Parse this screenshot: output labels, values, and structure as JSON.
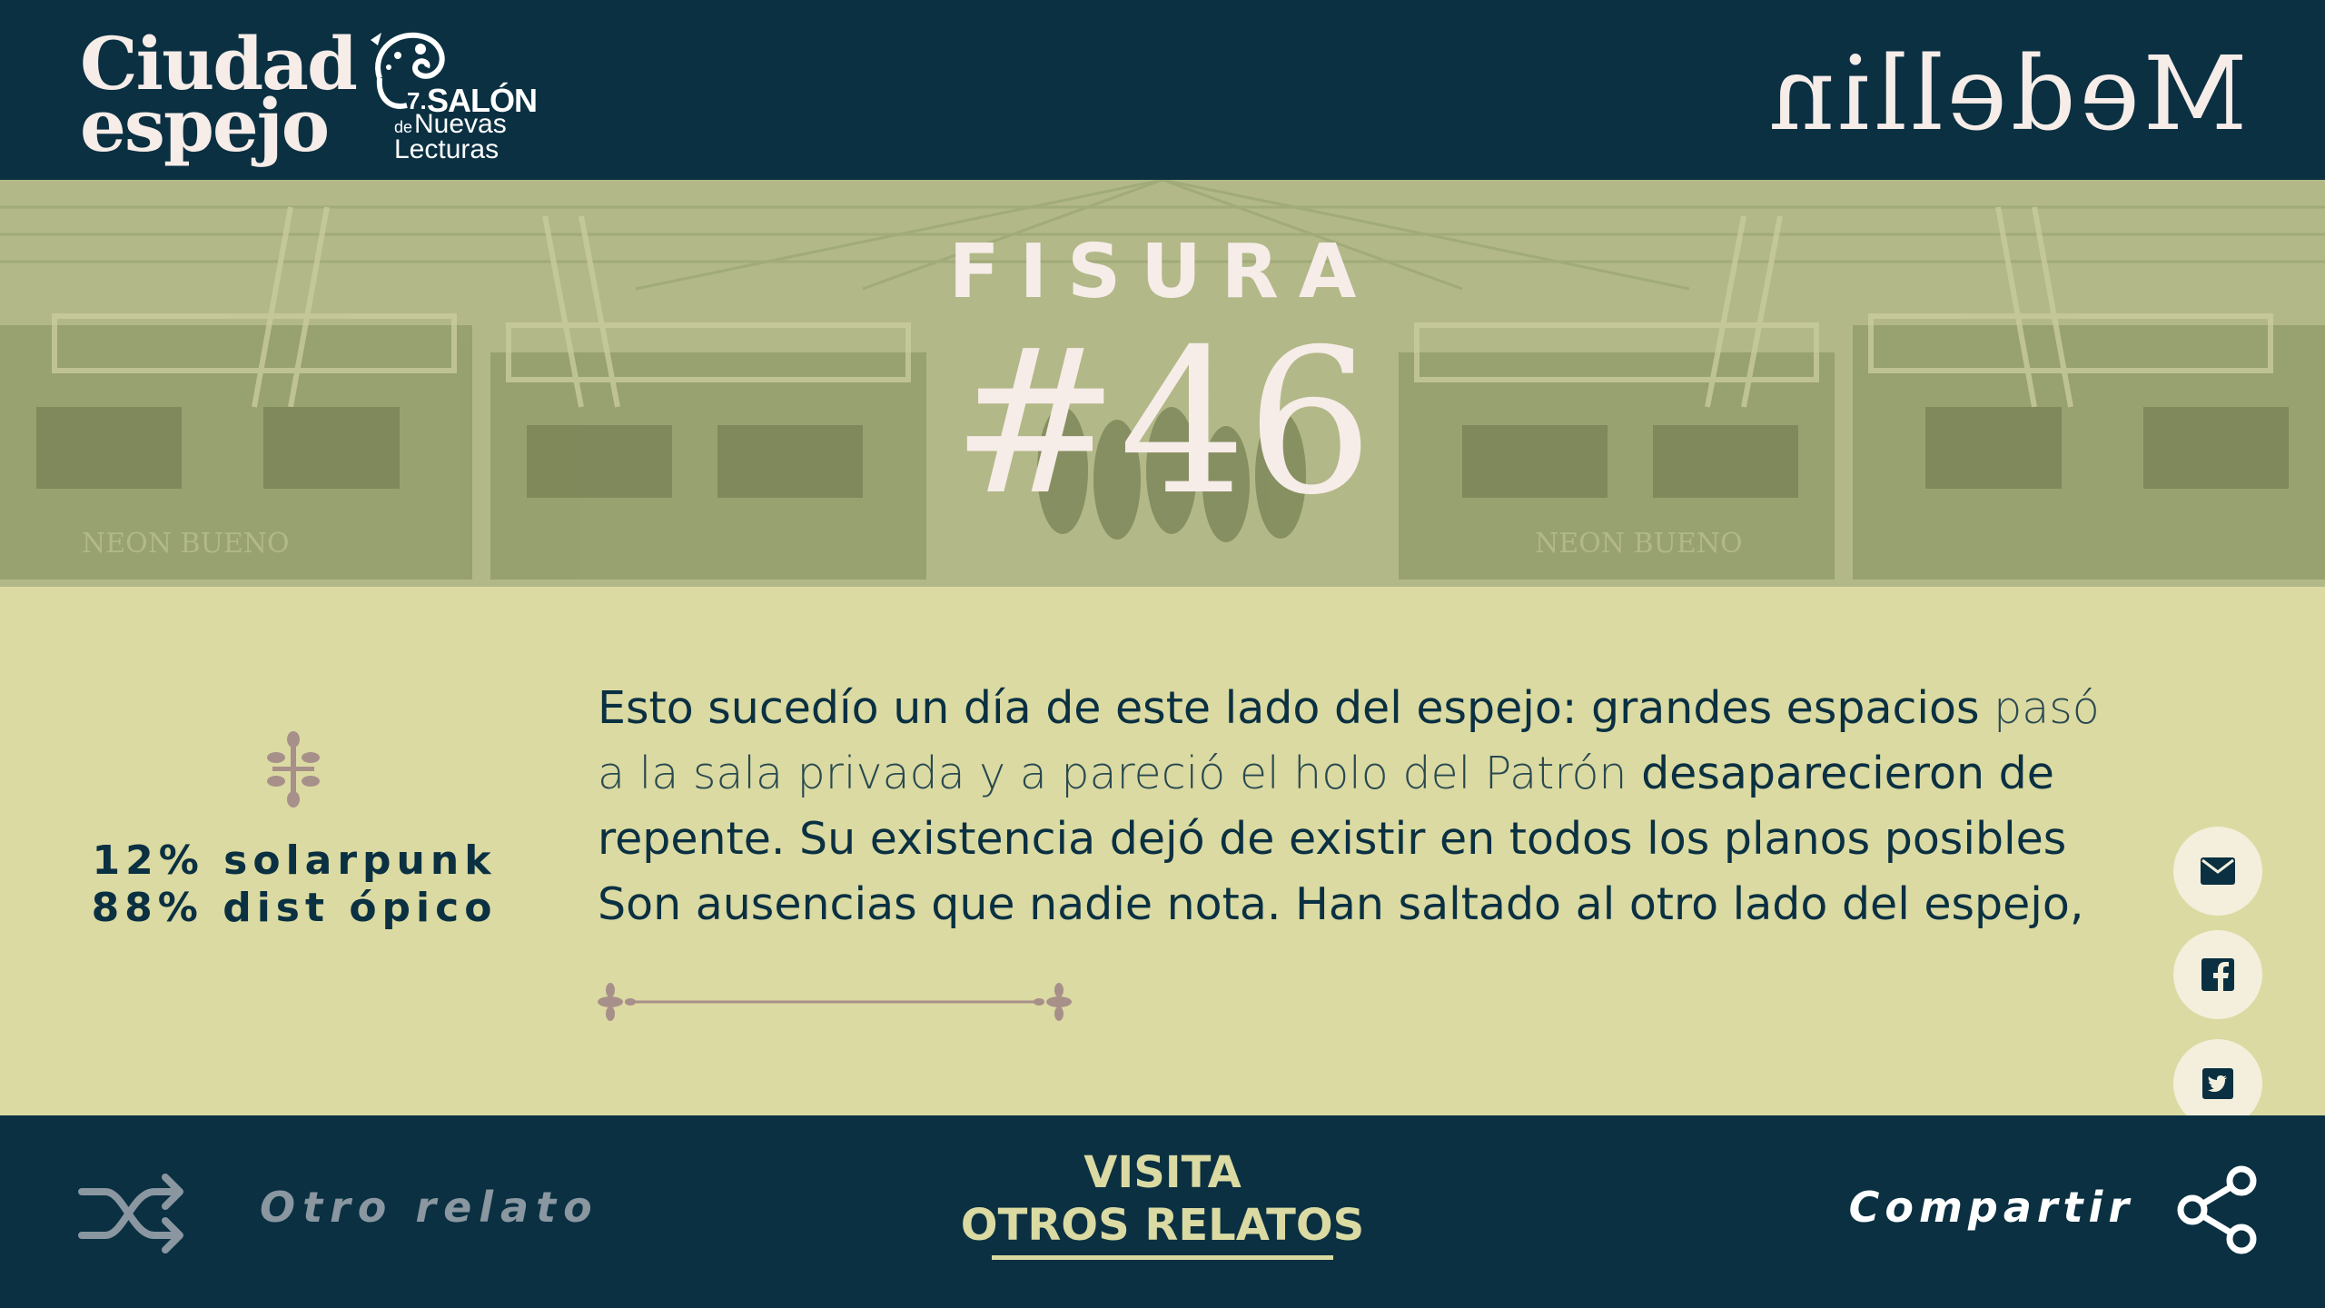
{
  "header": {
    "logo_ciudad_line1": "Ciudad",
    "logo_ciudad_line2": "espejo",
    "logo_salon": {
      "number": "7.",
      "title": "SALÓN",
      "de": "de",
      "nuevas": "Nuevas",
      "lecturas": "Lecturas"
    },
    "logo_medellin": "Medellin"
  },
  "banner": {
    "label": "FISURA",
    "number": "#46"
  },
  "story": {
    "genre_line1": "12% solarpunk",
    "genre_line2": "88% dist ópico",
    "lines": [
      {
        "a": "Esto sucedío  un día de este lado del espejo: grandes espacios ",
        "b": " pasó"
      },
      {
        "a": "a la sala privada y a pareció el holo del Patrón ",
        "b": " desaparecieron de"
      },
      {
        "a": "repente. Su existencia dejó de existir en todos los planos posibles",
        "b": ""
      },
      {
        "a": "Son ausencias que nadie nota. Han saltado al otro lado del espejo,",
        "b": ""
      }
    ]
  },
  "share_buttons": {
    "email": "mail-icon",
    "facebook": "facebook-icon",
    "twitter": "twitter-icon"
  },
  "footer": {
    "otro_relato": "Otro relato",
    "visita_line1": "VISITA",
    "visita_line2": "OTROS RELATOS",
    "compartir": "Compartir"
  },
  "colors": {
    "navy": "#0a3042",
    "cream": "#dbdaa2",
    "ornament": "#a8908a"
  }
}
